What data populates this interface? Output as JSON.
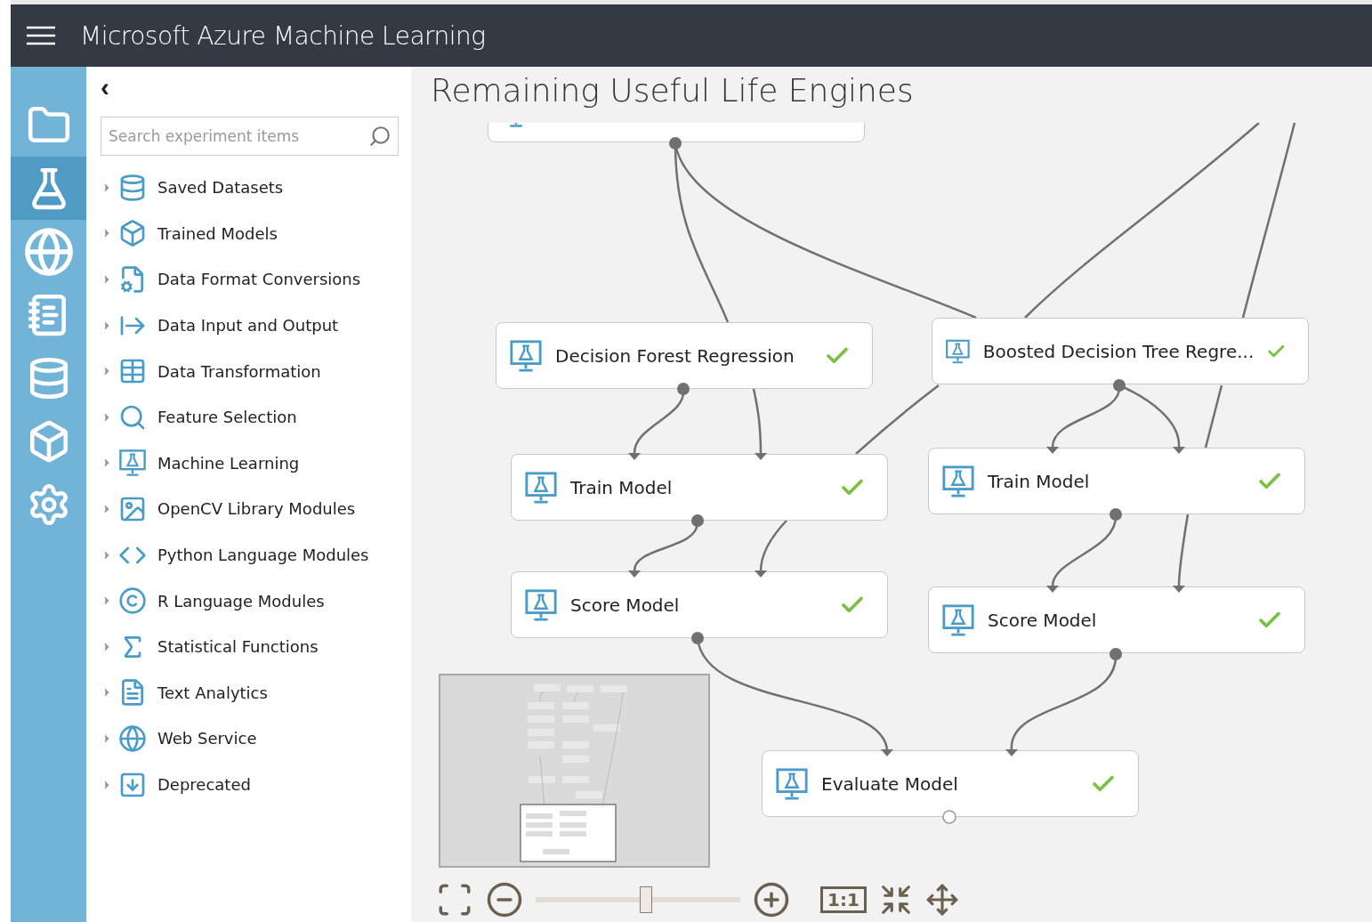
{
  "header": {
    "title": "Microsoft Azure Machine Learning"
  },
  "rail": [
    {
      "selected": false
    },
    {
      "selected": true
    },
    {
      "selected": false
    },
    {
      "selected": false
    },
    {
      "selected": false
    },
    {
      "selected": false
    },
    {
      "selected": false
    }
  ],
  "palette": {
    "collapse": "‹",
    "search": {
      "placeholder": "Search experiment items"
    },
    "categories": [
      {
        "label": "Saved Datasets",
        "expanded": false
      },
      {
        "label": "Trained Models",
        "expanded": false
      },
      {
        "label": "Data Format Conversions",
        "expanded": false
      },
      {
        "label": "Data Input and Output",
        "expanded": false
      },
      {
        "label": "Data Transformation",
        "expanded": false
      },
      {
        "label": "Feature Selection",
        "expanded": false
      },
      {
        "label": "Machine Learning",
        "expanded": false
      },
      {
        "label": "OpenCV Library Modules",
        "expanded": false
      },
      {
        "label": "Python Language Modules",
        "expanded": false
      },
      {
        "label": "R Language Modules",
        "expanded": false
      },
      {
        "label": "Statistical Functions",
        "expanded": false
      },
      {
        "label": "Text Analytics",
        "expanded": false
      },
      {
        "label": "Web Service",
        "expanded": false
      },
      {
        "label": "Deprecated",
        "expanded": false
      }
    ]
  },
  "experiment": {
    "title": "Remaining Useful Life Engines",
    "nodes": [
      {
        "done": false
      },
      {
        "title": "Decision Forest Regression",
        "done": true
      },
      {
        "title": "Boosted Decision Tree Regre...",
        "done": true
      },
      {
        "title": "Train Model",
        "done": true
      },
      {
        "title": "Train Model",
        "done": true
      },
      {
        "title": "Score Model",
        "done": true
      },
      {
        "title": "Score Model",
        "done": true
      },
      {
        "title": "Evaluate Model",
        "done": true
      }
    ]
  },
  "toolbar": {
    "zoom": {
      "level": 0.54
    },
    "actual_size": "1:1"
  }
}
